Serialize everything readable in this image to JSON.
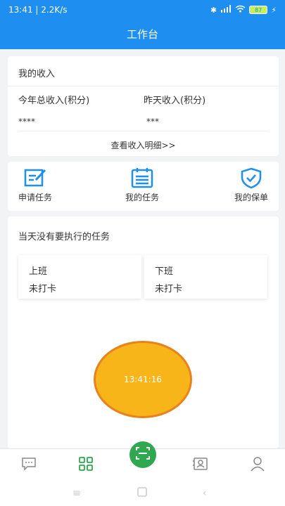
{
  "status_bar": {
    "time_speed": "13:41 | 2.2K/s",
    "battery_level": "87",
    "icons": [
      "bluetooth-icon",
      "hd-signal-icon",
      "wifi-icon",
      "battery-icon",
      "charging-icon"
    ]
  },
  "header": {
    "title": "工作台",
    "color": "#1e8ff0"
  },
  "income": {
    "title": "我的收入",
    "total_label": "今年总收入(积分)",
    "total_value": "****",
    "yesterday_label": "昨天收入(积分)",
    "yesterday_value": "***",
    "details_link": "查看收入明细>>"
  },
  "actions": [
    {
      "label": "申请任务",
      "icon": "edit-task-icon"
    },
    {
      "label": "我的任务",
      "icon": "task-list-icon"
    },
    {
      "label": "我的保单",
      "icon": "shield-check-icon"
    }
  ],
  "tasks": {
    "message": "当天没有要执行的任务",
    "shifts": [
      {
        "label": "上班",
        "status": "未打卡"
      },
      {
        "label": "下班",
        "status": "未打卡"
      }
    ]
  },
  "clock": {
    "time": "13:41:16",
    "color": "#f7b51a"
  },
  "tabbar": {
    "icons": [
      "message-icon",
      "grid-icon",
      "scan-icon",
      "contact-card-icon",
      "profile-icon"
    ],
    "active_color": "#2fa84f"
  }
}
